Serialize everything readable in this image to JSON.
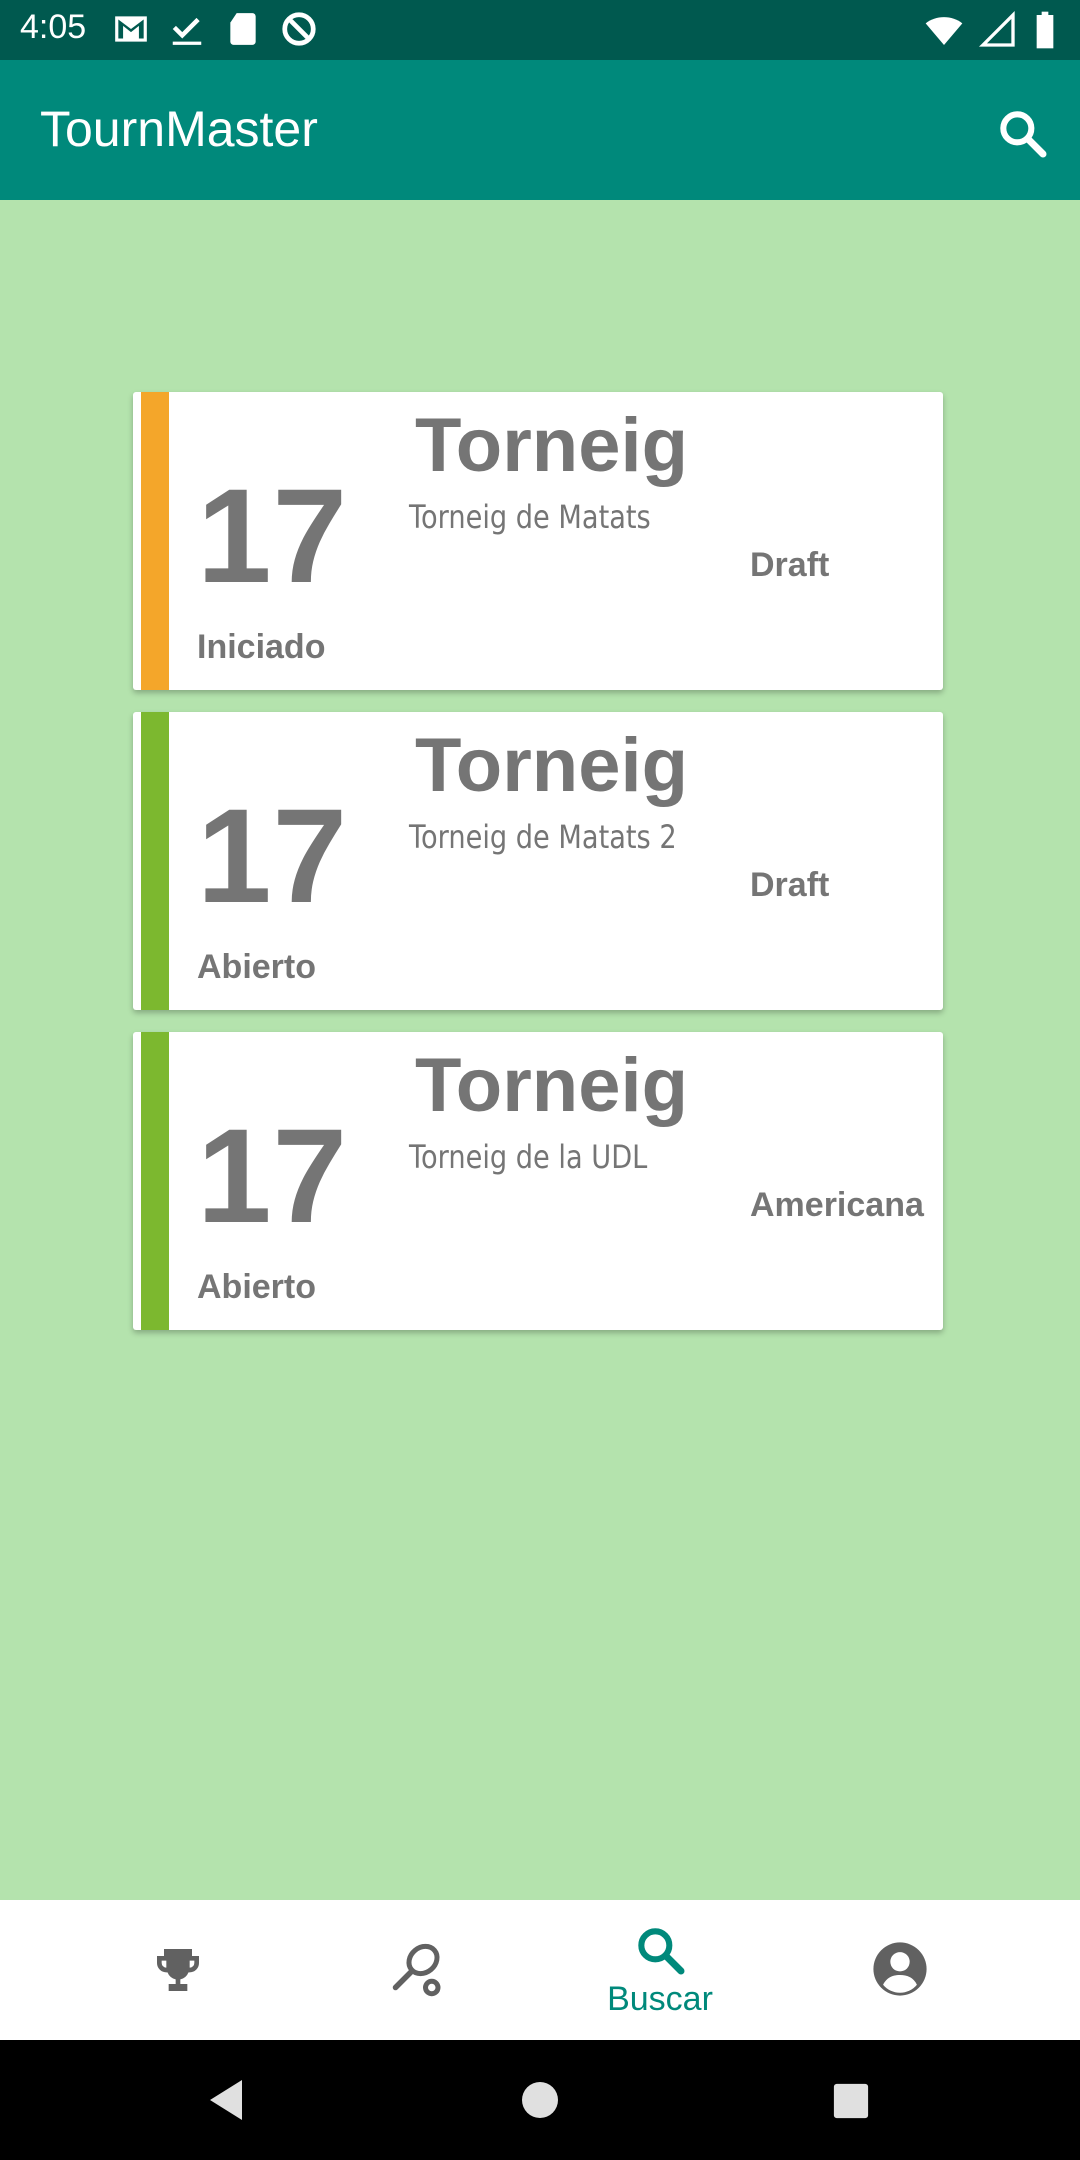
{
  "status_bar": {
    "time": "4:05"
  },
  "app_bar": {
    "title": "TournMaster"
  },
  "tournaments": [
    {
      "number": "17",
      "title": "Torneig",
      "subtitle": "Torneig de Matats",
      "type": "Draft",
      "status": "Iniciado",
      "accent": "#f4a62a"
    },
    {
      "number": "17",
      "title": "Torneig",
      "subtitle": "Torneig de Matats 2",
      "type": "Draft",
      "status": "Abierto",
      "accent": "#7cb82f"
    },
    {
      "number": "17",
      "title": "Torneig",
      "subtitle": "Torneig de la UDL",
      "type": "Americana",
      "status": "Abierto",
      "accent": "#7cb82f"
    }
  ],
  "bottom_nav": {
    "items": [
      {
        "icon": "trophy-icon"
      },
      {
        "icon": "tennis-racket-icon"
      },
      {
        "icon": "search-icon",
        "label": "Buscar",
        "active": true
      },
      {
        "icon": "account-icon"
      }
    ]
  },
  "colors": {
    "primary": "#00897b",
    "primary_dark": "#00594f",
    "background": "#b4e3ad",
    "text_gray": "#757575"
  }
}
